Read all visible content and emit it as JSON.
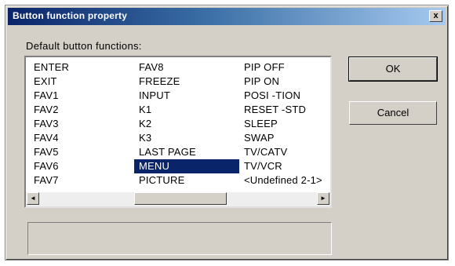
{
  "window": {
    "title": "Button function property",
    "close_label": "x"
  },
  "section": {
    "label": "Default button functions:"
  },
  "list": {
    "columns": [
      [
        "ENTER",
        "EXIT",
        "FAV1",
        "FAV2",
        "FAV3",
        "FAV4",
        "FAV5",
        "FAV6",
        "FAV7"
      ],
      [
        "FAV8",
        "FREEZE",
        "INPUT",
        "K1",
        "K2",
        "K3",
        "LAST PAGE",
        "MENU",
        "PICTURE"
      ],
      [
        "PIP OFF",
        "PIP ON",
        "POSI -TION",
        "RESET -STD",
        "SLEEP",
        "SWAP",
        "TV/CATV",
        "TV/VCR",
        "<Undefined 2-1>"
      ]
    ],
    "selected": "MENU"
  },
  "scrollbar": {
    "left_arrow": "◄",
    "right_arrow": "►"
  },
  "buttons": {
    "ok_label": "OK",
    "cancel_label": "Cancel"
  },
  "description": {
    "text": ""
  },
  "colors": {
    "dialog_bg": "#d4d0c8",
    "title_start": "#0a246a",
    "title_end": "#a6caf0",
    "selection": "#0a246a"
  }
}
